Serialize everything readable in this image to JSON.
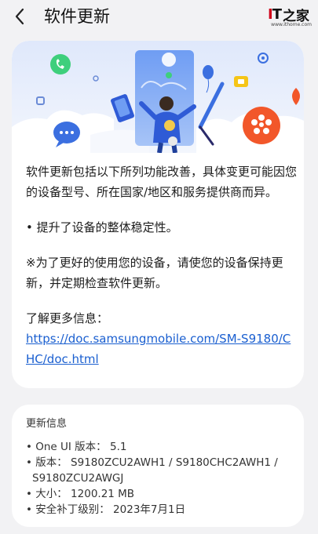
{
  "header": {
    "title": "软件更新",
    "back_icon": "back-arrow-icon"
  },
  "watermark": {
    "logo_text": "IT之家",
    "url": "www.ithome.com"
  },
  "main": {
    "paragraphs": [
      "软件更新包括以下所列功能改善，具体变更可能因您的设备型号、所在国家/地区和服务提供商而异。",
      "• 提升了设备的整体稳定性。",
      "※为了更好的使用您的设备，请使您的设备保持更新，并定期检查软件更新。"
    ],
    "more_info_label": "了解更多信息：",
    "more_info_link": "https://doc.samsungmobile.com/SM-S9180/CHC/doc.html"
  },
  "info": {
    "title": "更新信息",
    "one_ui": "• One UI 版本： 5.1",
    "version_line1": "• 版本： S9180ZCU2AWH1 / S9180CHC2AWH1 /",
    "version_line2": "S9180ZCU2AWGJ",
    "size": "• 大小： 1200.21 MB",
    "security_patch": "• 安全补丁级别： 2023年7月1日"
  },
  "colors": {
    "background": "#f2f2f4",
    "card": "#ffffff",
    "link": "#1a5fd0",
    "accent_orange": "#f2572a",
    "accent_green": "#3ecf7c",
    "accent_blue": "#3b6fe0"
  }
}
